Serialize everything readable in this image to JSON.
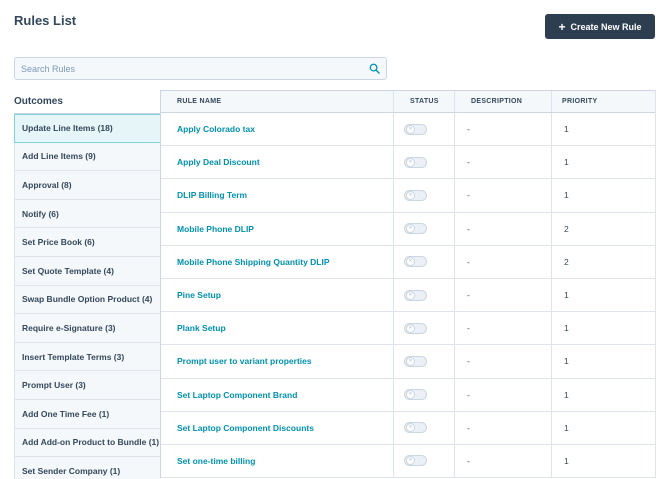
{
  "header": {
    "title": "Rules List",
    "create_label": "Create New Rule",
    "create_icon": "plus-icon"
  },
  "search": {
    "placeholder": "Search Rules",
    "value": ""
  },
  "outcomes": {
    "title": "Outcomes",
    "items": [
      {
        "label": "Update Line Items (18)",
        "active": true
      },
      {
        "label": "Add Line Items (9)"
      },
      {
        "label": "Approval (8)"
      },
      {
        "label": "Notify (6)"
      },
      {
        "label": "Set Price Book (6)"
      },
      {
        "label": "Set Quote Template (4)"
      },
      {
        "label": "Swap Bundle Option Product (4)"
      },
      {
        "label": "Require e-Signature (3)"
      },
      {
        "label": "Insert Template Terms (3)"
      },
      {
        "label": "Prompt User (3)"
      },
      {
        "label": "Add One Time Fee (1)"
      },
      {
        "label": "Add Add-on Product to Bundle (1)"
      },
      {
        "label": "Set Sender Company (1)"
      }
    ]
  },
  "table": {
    "headers": {
      "name": "RULE NAME",
      "status": "STATUS",
      "description": "DESCRIPTION",
      "priority": "PRIORITY"
    },
    "rows": [
      {
        "name": "Apply Colorado tax",
        "status": "off",
        "description": "-",
        "priority": "1"
      },
      {
        "name": "Apply Deal Discount",
        "status": "off",
        "description": "-",
        "priority": "1"
      },
      {
        "name": "DLIP Billing Term",
        "status": "off",
        "description": "-",
        "priority": "1"
      },
      {
        "name": "Mobile Phone DLIP",
        "status": "off",
        "description": "-",
        "priority": "2"
      },
      {
        "name": "Mobile Phone Shipping Quantity DLIP",
        "status": "off",
        "description": "-",
        "priority": "2"
      },
      {
        "name": "Pine Setup",
        "status": "off",
        "description": "-",
        "priority": "1"
      },
      {
        "name": "Plank Setup",
        "status": "off",
        "description": "-",
        "priority": "1"
      },
      {
        "name": "Prompt user to variant properties",
        "status": "off",
        "description": "-",
        "priority": "1"
      },
      {
        "name": "Set Laptop Component Brand",
        "status": "off",
        "description": "-",
        "priority": "1"
      },
      {
        "name": "Set Laptop Component Discounts",
        "status": "off",
        "description": "-",
        "priority": "1"
      },
      {
        "name": "Set one-time billing",
        "status": "off",
        "description": "-",
        "priority": "1"
      }
    ]
  },
  "colors": {
    "primary_button": "#2d3e50",
    "link": "#0091ae",
    "active_outcome_bg": "#e5f5f8",
    "active_outcome_border": "#7fd1de"
  }
}
